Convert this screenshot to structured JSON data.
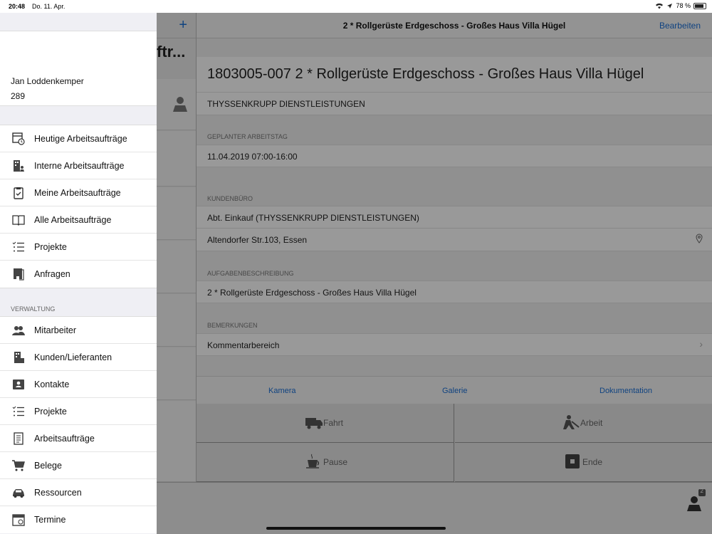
{
  "status": {
    "time": "20:48",
    "date": "Do. 11. Apr.",
    "battery": "78 %"
  },
  "master": {
    "title_fragment": "ftr..."
  },
  "detail": {
    "nav_title": "2 * Rollgerüste Erdgeschoss - Großes Haus Villa Hügel",
    "edit_button": "Bearbeiten",
    "headline": "1803005-007 2 * Rollgerüste Erdgeschoss - Großes Haus Villa Hügel",
    "company": "THYSSENKRUPP DIENSTLEISTUNGEN",
    "sections": {
      "planned": "GEPLANTER ARBEITSTAG",
      "office": "KUNDENBÜRO",
      "task": "AUFGABENBESCHREIBUNG",
      "remarks": "BEMERKUNGEN"
    },
    "planned_value": "11.04.2019 07:00-16:00",
    "office_name": "Abt. Einkauf (THYSSENKRUPP DIENSTLEISTUNGEN)",
    "office_address": "Altendorfer Str.103, Essen",
    "task_value": "2 * Rollgerüste Erdgeschoss - Großes Haus Villa Hügel",
    "remarks_value": "Kommentarbereich",
    "tabs": [
      "Kamera",
      "Galerie",
      "Dokumentation"
    ],
    "actions": {
      "drive": "Fahrt",
      "work": "Arbeit",
      "pause": "Pause",
      "end": "Ende"
    },
    "badge_count": "2"
  },
  "menu": {
    "user_name": "Jan Loddenkemper",
    "user_number": "289",
    "items": [
      {
        "label": "Heutige Arbeitsaufträge",
        "icon": "calendar-clock-icon"
      },
      {
        "label": "Interne Arbeitsaufträge",
        "icon": "building-person-icon"
      },
      {
        "label": "Meine Arbeitsaufträge",
        "icon": "clipboard-check-icon"
      },
      {
        "label": "Alle Arbeitsaufträge",
        "icon": "book-icon"
      },
      {
        "label": "Projekte",
        "icon": "list-icon"
      },
      {
        "label": "Anfragen",
        "icon": "inbox-icon"
      }
    ],
    "admin_header": "VERWALTUNG",
    "admin_items": [
      {
        "label": "Mitarbeiter",
        "icon": "people-icon"
      },
      {
        "label": "Kunden/Lieferanten",
        "icon": "building-icon"
      },
      {
        "label": "Kontakte",
        "icon": "contact-card-icon"
      },
      {
        "label": "Projekte",
        "icon": "list-icon"
      },
      {
        "label": "Arbeitsaufträge",
        "icon": "document-list-icon"
      },
      {
        "label": "Belege",
        "icon": "cart-icon"
      },
      {
        "label": "Ressourcen",
        "icon": "car-icon"
      },
      {
        "label": "Termine",
        "icon": "calendar-icon"
      }
    ]
  }
}
